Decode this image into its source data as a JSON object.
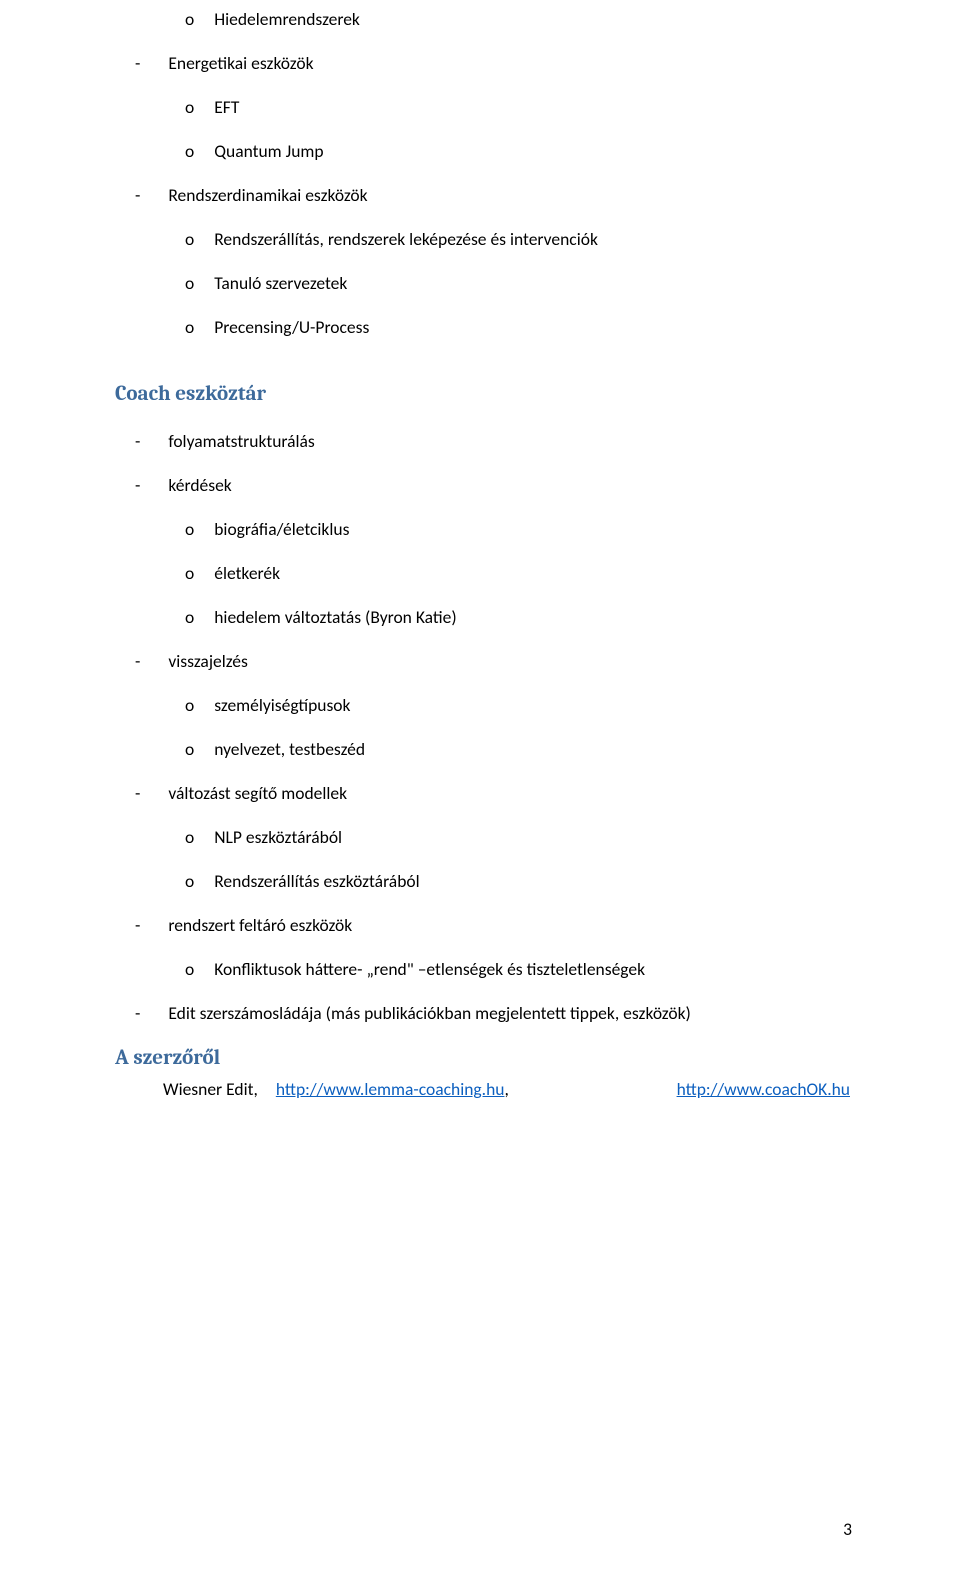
{
  "items": {
    "hiedelem": "Hiedelemrendszerek",
    "energ": "Energetikai eszközök",
    "eft": "EFT",
    "quantum": "Quantum Jump",
    "rendszerdin": "Rendszerdinamikai eszközök",
    "rendszerall": "Rendszerállítás, rendszerek leképezése és intervenciók",
    "tanulo": "Tanuló szervezetek",
    "precens": "Precensing/U-Process"
  },
  "heading_coach": "Coach eszköztár",
  "coach": {
    "folyamat": "folyamatstrukturálás",
    "kerdesek": "kérdések",
    "biografia": "biográfia/életciklus",
    "eletkerek": "életkerék",
    "hiedelemvalt": "hiedelem változtatás (Byron Katie)",
    "visszajelzes": "visszajelzés",
    "szemelyiseg": "személyiségtípusok",
    "nyelvezet": "nyelvezet, testbeszéd",
    "valtozast": "változást segítő modellek",
    "nlp": "NLP eszköztárából",
    "rendszerallesz": "Rendszerállítás eszköztárából",
    "rendszertfelt": "rendszert feltáró eszközök",
    "konflikt": "Konfliktusok háttere- „rend\" –etlenségek és tiszteletlenségek",
    "editszer": "Edit szerszámosládája (más publikációkban megjelentett tippek, eszközök)"
  },
  "heading_author": "A szerzőről",
  "author": {
    "name": "Wiesner Edit,",
    "link1_text": "http://www.lemma-coaching.hu",
    "link1_comma": ",",
    "link2_text": "http://www.coachOK.hu"
  },
  "page_number": "3",
  "bullet_o": "o",
  "bullet_dash": "-"
}
